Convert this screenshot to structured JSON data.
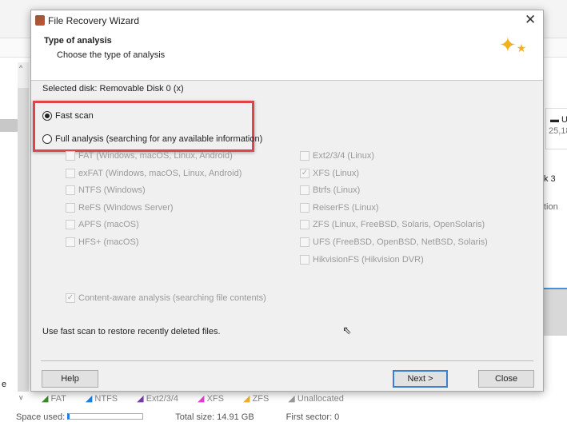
{
  "dialog": {
    "title": "File Recovery Wizard",
    "header_title": "Type of analysis",
    "header_subtitle": "Choose the type of analysis",
    "selected_disk": "Selected disk: Removable Disk 0 (x)",
    "options": [
      {
        "label": "Fast scan",
        "selected": true
      },
      {
        "label": "Full analysis (searching for any available information)",
        "selected": false
      }
    ],
    "fs_left": [
      {
        "label": "FAT (Windows, macOS, Linux, Android)",
        "checked": false
      },
      {
        "label": "exFAT (Windows, macOS, Linux, Android)",
        "checked": false
      },
      {
        "label": "NTFS (Windows)",
        "checked": false
      },
      {
        "label": "ReFS (Windows Server)",
        "checked": false
      },
      {
        "label": "APFS (macOS)",
        "checked": false
      },
      {
        "label": "HFS+ (macOS)",
        "checked": false
      }
    ],
    "fs_right": [
      {
        "label": "Ext2/3/4 (Linux)",
        "checked": false
      },
      {
        "label": "XFS (Linux)",
        "checked": true
      },
      {
        "label": "Btrfs (Linux)",
        "checked": false
      },
      {
        "label": "ReiserFS (Linux)",
        "checked": false
      },
      {
        "label": "ZFS (Linux, FreeBSD, Solaris, OpenSolaris)",
        "checked": false
      },
      {
        "label": "UFS (FreeBSD, OpenBSD, NetBSD, Solaris)",
        "checked": false
      },
      {
        "label": "HikvisionFS (Hikvision DVR)",
        "checked": false
      }
    ],
    "content_aware": {
      "label": "Content-aware analysis (searching file contents)",
      "checked": true
    },
    "hint": "Use fast scan to restore recently deleted files.",
    "buttons": {
      "help": "Help",
      "next": "Next >",
      "close": "Close"
    },
    "highlight_color": "#e0444a"
  },
  "background": {
    "right_size": "25,18",
    "right_disk": "k 3",
    "right_label": "tion",
    "left_fragment": "e",
    "legend": [
      {
        "label": "FAT",
        "color": "#3a8a2a"
      },
      {
        "label": "NTFS",
        "color": "#1e7fe0"
      },
      {
        "label": "Ext2/3/4",
        "color": "#7a3aa8"
      },
      {
        "label": "XFS",
        "color": "#e040d0"
      },
      {
        "label": "ZFS",
        "color": "#f0b020"
      },
      {
        "label": "Unallocated",
        "color": "#999999"
      }
    ],
    "space_used": "Space used:",
    "total_size": "Total size: 14.91 GB",
    "first_sector": "First sector: 0"
  }
}
